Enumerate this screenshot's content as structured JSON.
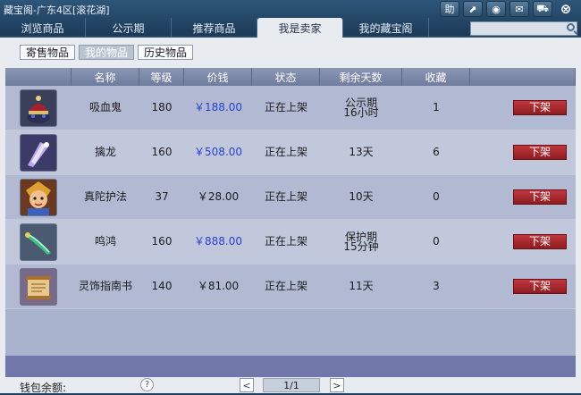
{
  "window": {
    "title": "藏宝阁-广东4区[滚花湖]"
  },
  "title_buttons": [
    {
      "name": "help-button",
      "icon": "help-icon",
      "glyph": "助"
    },
    {
      "name": "share-button",
      "icon": "share-icon",
      "glyph": "⬈"
    },
    {
      "name": "record-button",
      "icon": "record-icon",
      "glyph": "◉"
    },
    {
      "name": "chat-button",
      "icon": "chat-icon",
      "glyph": "✉"
    },
    {
      "name": "cart-button",
      "icon": "cart-icon",
      "glyph": "⛟"
    },
    {
      "name": "close-button",
      "icon": "close-icon",
      "glyph": "⊗"
    }
  ],
  "tabs": [
    {
      "label": "浏览商品",
      "active": false
    },
    {
      "label": "公示期",
      "active": false
    },
    {
      "label": "推荐商品",
      "active": false
    },
    {
      "label": "我是卖家",
      "active": true
    },
    {
      "label": "我的藏宝阁",
      "active": false
    }
  ],
  "search": {
    "value": "",
    "placeholder": ""
  },
  "subtabs": [
    {
      "label": "寄售物品",
      "active": false
    },
    {
      "label": "我的物品",
      "active": true
    },
    {
      "label": "历史物品",
      "active": false
    }
  ],
  "columns": [
    "",
    "名称",
    "等级",
    "价钱",
    "状态",
    "剩余天数",
    "收藏",
    ""
  ],
  "items": [
    {
      "icon": "hat-icon",
      "name": "吸血鬼",
      "level": "180",
      "price": "￥188.00",
      "price_highlight": true,
      "status": "正在上架",
      "remaining": "公示期\n16小时",
      "favorites": "1",
      "action": "下架"
    },
    {
      "icon": "crystal-icon",
      "name": "擒龙",
      "level": "160",
      "price": "￥508.00",
      "price_highlight": true,
      "status": "正在上架",
      "remaining": "13天",
      "favorites": "6",
      "action": "下架"
    },
    {
      "icon": "warrior-portrait-icon",
      "name": "真陀护法",
      "level": "37",
      "price": "￥28.00",
      "price_highlight": false,
      "status": "正在上架",
      "remaining": "10天",
      "favorites": "0",
      "action": "下架"
    },
    {
      "icon": "jade-weapon-icon",
      "name": "鸣鸿",
      "level": "160",
      "price": "￥888.00",
      "price_highlight": true,
      "status": "正在上架",
      "remaining": "保护期\n15分钟",
      "favorites": "0",
      "action": "下架"
    },
    {
      "icon": "scroll-icon",
      "name": "灵饰指南书",
      "level": "140",
      "price": "￥81.00",
      "price_highlight": false,
      "status": "正在上架",
      "remaining": "11天",
      "favorites": "3",
      "action": "下架"
    }
  ],
  "footer": {
    "wallet_label": "钱包余额:",
    "help_glyph": "?",
    "prev_glyph": "<",
    "next_glyph": ">",
    "page_info": "1/1"
  },
  "colors": {
    "unlist_button": "#a8262b",
    "price_blue": "#2b3fd0",
    "tab_active": "#e8ecf1"
  }
}
